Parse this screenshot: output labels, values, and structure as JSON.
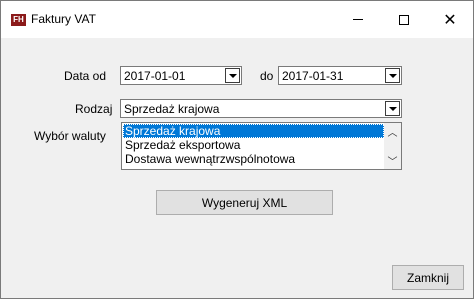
{
  "window": {
    "title": "Faktury VAT",
    "icon": "app-logo-icon"
  },
  "form": {
    "date_from_label": "Data od",
    "date_from_value": "2017-01-01",
    "date_to_label": "do",
    "date_to_value": "2017-01-31",
    "type_label": "Rodzaj",
    "type_value": "Sprzedaż krajowa",
    "currency_label": "Wybór waluty",
    "type_options": [
      "Sprzedaż krajowa",
      "Sprzedaż eksportowa",
      "Dostawa wewnątrzwspólnotowa"
    ]
  },
  "buttons": {
    "generate": "Wygeneruj XML",
    "close": "Zamknij"
  },
  "accent_color": "#0078d7"
}
